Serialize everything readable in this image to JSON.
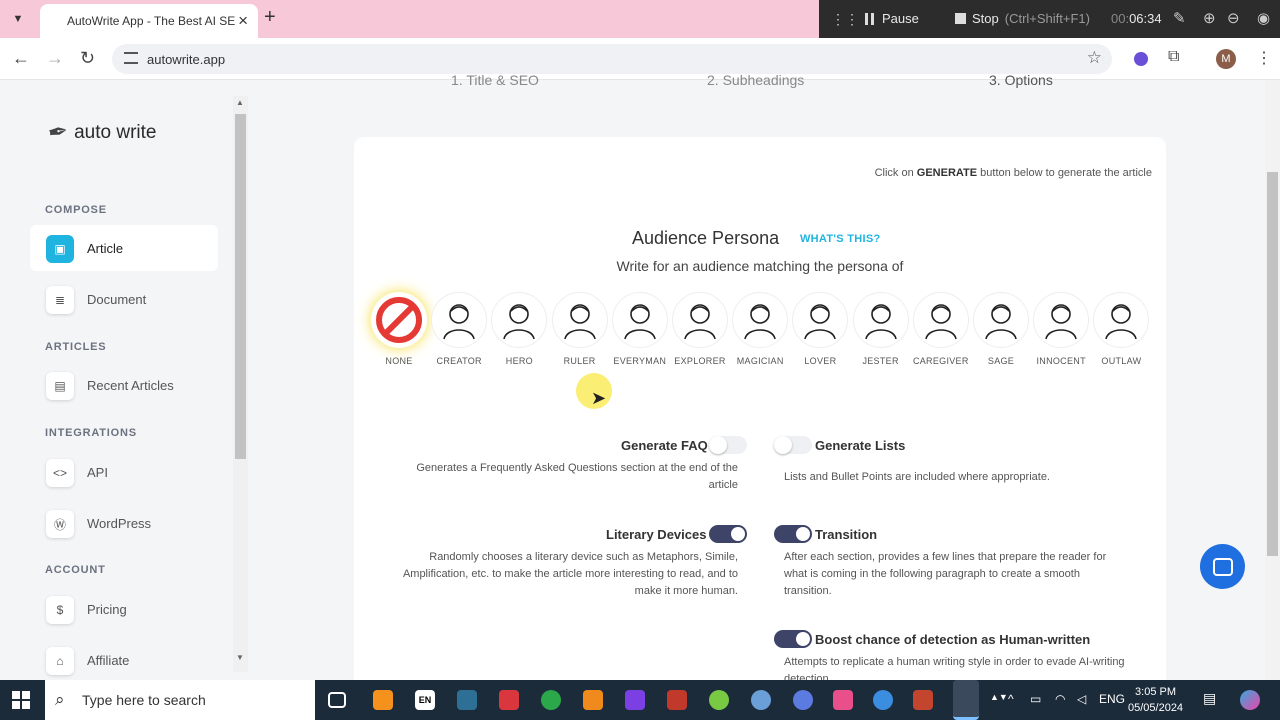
{
  "browser": {
    "tab_title": "AutoWrite App - The Best AI SE",
    "url": "autowrite.app"
  },
  "recorder": {
    "pause_label": "Pause",
    "stop_label": "Stop",
    "stop_hint": "(Ctrl+Shift+F1)",
    "timer_prefix": "00:",
    "timer": "06:34"
  },
  "profile_initial": "M",
  "sidebar": {
    "brand": "auto write",
    "sections": [
      {
        "label": "COMPOSE",
        "items": [
          {
            "label": "Article",
            "icon": "article-icon"
          },
          {
            "label": "Document",
            "icon": "document-icon"
          }
        ]
      },
      {
        "label": "ARTICLES",
        "items": [
          {
            "label": "Recent Articles",
            "icon": "recent-articles-icon"
          }
        ]
      },
      {
        "label": "INTEGRATIONS",
        "items": [
          {
            "label": "API",
            "icon": "code-icon"
          },
          {
            "label": "WordPress",
            "icon": "wordpress-icon"
          }
        ]
      },
      {
        "label": "ACCOUNT",
        "items": [
          {
            "label": "Pricing",
            "icon": "dollar-icon"
          },
          {
            "label": "Affiliate",
            "icon": "bank-icon"
          }
        ]
      }
    ]
  },
  "steps": [
    "1. Title & SEO",
    "2. Subheadings",
    "3. Options"
  ],
  "main": {
    "generate_hint_prefix": "Click on ",
    "generate_hint_bold": "GENERATE",
    "generate_hint_suffix": " button below to generate the article",
    "persona_title": "Audience Persona",
    "whats_this": "WHAT'S THIS?",
    "persona_subtitle": "Write for an audience matching the persona of",
    "personas": [
      "NONE",
      "CREATOR",
      "HERO",
      "RULER",
      "EVERYMAN",
      "EXPLORER",
      "MAGICIAN",
      "LOVER",
      "JESTER",
      "CAREGIVER",
      "SAGE",
      "INNOCENT",
      "OUTLAW"
    ],
    "selected_persona": "NONE",
    "options": {
      "faq": {
        "title": "Generate FAQ",
        "desc": "Generates a Frequently Asked Questions section at the end of the article",
        "enabled": false
      },
      "lists": {
        "title": "Generate Lists",
        "desc": "Lists and Bullet Points are included where appropriate.",
        "enabled": false
      },
      "literary": {
        "title": "Literary Devices",
        "desc": "Randomly chooses a literary device such as Metaphors, Simile, Amplification, etc. to make the article more interesting to read, and to make it more human.",
        "enabled": true
      },
      "transition": {
        "title": "Transition",
        "desc": "After each section, provides a few lines that prepare the reader for what is coming in the following paragraph to create a smooth transition.",
        "enabled": true
      },
      "human": {
        "title": "Boost chance of detection as Human-written",
        "desc": "Attempts to replicate a human writing style in order to evade AI-writing detection.",
        "enabled": true
      }
    }
  },
  "taskbar": {
    "search_placeholder": "Type here to search",
    "language": "ENG",
    "time": "3:05 PM",
    "date": "05/05/2024",
    "en_badge": "EN"
  },
  "colors": {
    "accent": "#1fb4e0",
    "toggle_on": "#3d4468",
    "chat": "#1f6fe0"
  }
}
